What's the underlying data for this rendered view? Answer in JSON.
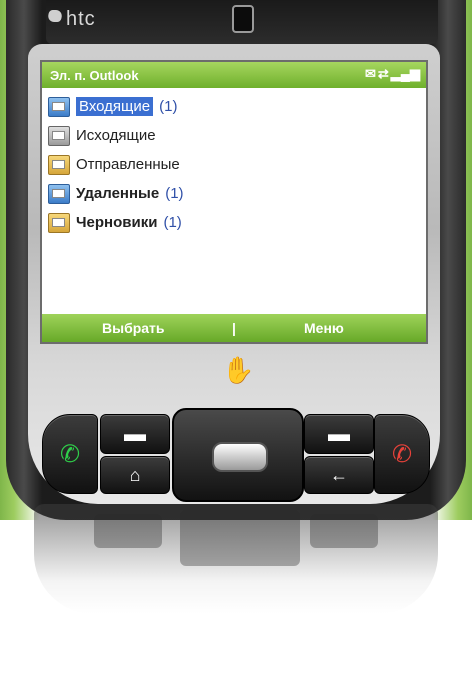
{
  "device": {
    "brand": "htc"
  },
  "title_bar": {
    "title": "Эл. п. Outlook",
    "icons": [
      "mail-icon",
      "sync-icon",
      "signal-icon"
    ]
  },
  "folders": [
    {
      "name": "Входящие",
      "count": "(1)",
      "selected": true,
      "bold": false,
      "icon": "inbox-folder-icon"
    },
    {
      "name": "Исходящие",
      "count": "",
      "selected": false,
      "bold": false,
      "icon": "outbox-folder-icon"
    },
    {
      "name": "Отправленные",
      "count": "",
      "selected": false,
      "bold": false,
      "icon": "sent-folder-icon"
    },
    {
      "name": "Удаленные",
      "count": "(1)",
      "selected": false,
      "bold": true,
      "icon": "deleted-folder-icon"
    },
    {
      "name": "Черновики",
      "count": "(1)",
      "selected": false,
      "bold": true,
      "icon": "drafts-folder-icon"
    }
  ],
  "softkeys": {
    "left": "Выбрать",
    "separator": "|",
    "right": "Меню"
  },
  "colors": {
    "accent_green": "#7cbf35",
    "selection_blue": "#3b6fd1",
    "count_blue": "#3050a8"
  }
}
